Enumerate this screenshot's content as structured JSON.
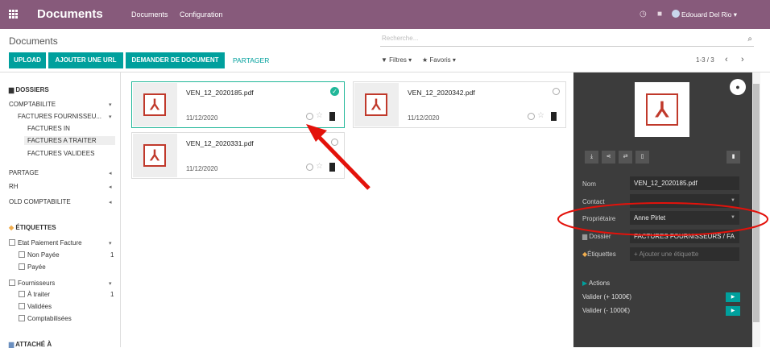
{
  "nav": {
    "app_title": "Documents",
    "menu": [
      "Documents",
      "Configuration"
    ],
    "user": "Edouard Del Rio",
    "icons": [
      "apps-grid-icon",
      "clock-icon",
      "chat-icon",
      "avatar",
      "caret-down-icon"
    ]
  },
  "control_panel": {
    "breadcrumb": "Documents",
    "search_placeholder": "Recherche...",
    "buttons": [
      "UPLOAD",
      "AJOUTER UNE URL",
      "DEMANDER DE DOCUMENT"
    ],
    "share_link": "PARTAGER",
    "filters": "Filtres",
    "favorites": "Favoris",
    "pager": "1-3 / 3",
    "accent_color": "#00a09d"
  },
  "sidebar": {
    "folders_heading": "DOSSIERS",
    "folders": [
      "COMPTABILITE",
      "FACTURES FOURNISSEU...",
      "FACTURES IN",
      "FACTURES A TRAITER",
      "FACTURES VALIDEES",
      "PARTAGE",
      "RH",
      "OLD COMPTABILITE"
    ],
    "selected_folder": "FACTURES A TRAITER",
    "tags_heading": "ÉTIQUETTES",
    "tag_groups": [
      {
        "label": "Etat Paiement Facture",
        "items": [
          {
            "label": "Non Payée",
            "count": "1"
          },
          {
            "label": "Payée",
            "count": ""
          }
        ]
      },
      {
        "label": "Fournisseurs",
        "items": [
          {
            "label": "À traiter",
            "count": "1"
          },
          {
            "label": "Validées",
            "count": ""
          },
          {
            "label": "Comptabilisées",
            "count": ""
          }
        ]
      }
    ],
    "attached_heading": "ATTACHÉ À"
  },
  "documents": [
    {
      "name": "VEN_12_2020185.pdf",
      "date": "11/12/2020",
      "selected": true
    },
    {
      "name": "VEN_12_2020342.pdf",
      "date": "11/12/2020",
      "selected": false
    },
    {
      "name": "VEN_12_2020331.pdf",
      "date": "11/12/2020",
      "selected": false
    }
  ],
  "details": {
    "labels": {
      "name": "Nom",
      "contact": "Contact",
      "owner": "Propriétaire",
      "folder": "Dossier",
      "tags": "Étiquettes"
    },
    "name": "VEN_12_2020185.pdf",
    "contact": "",
    "owner": "Anne Pirlet",
    "folder": "FACTURES FOURNISSEURS / FA",
    "tags_placeholder": "+ Ajouter une étiquette",
    "actions_heading": "Actions",
    "actions": [
      "Valider (+ 1000€)",
      "Valider (- 1000€)"
    ]
  },
  "annotations": {
    "arrow_color": "#e3120b",
    "ellipse_color": "#e3120b"
  }
}
